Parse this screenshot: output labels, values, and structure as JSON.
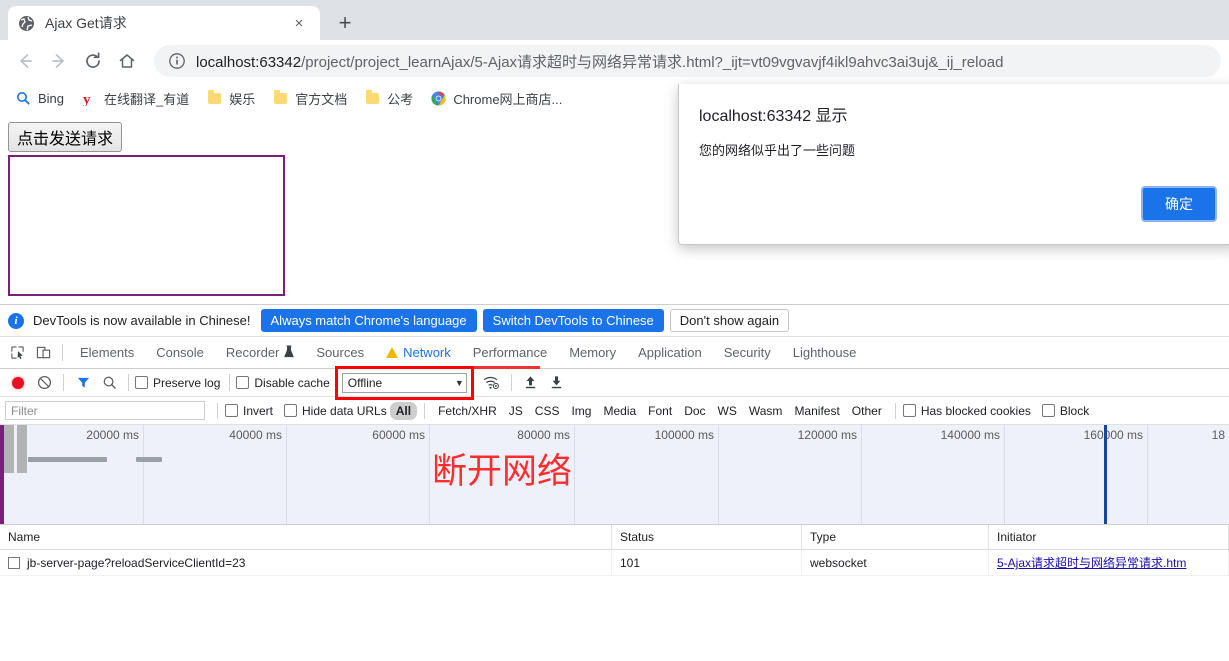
{
  "browser": {
    "tab": {
      "title": "Ajax Get请求",
      "favicon": "globe-icon",
      "close": "×"
    },
    "new_tab_label": "+",
    "nav": {
      "back": "←",
      "forward": "→",
      "reload": "⟳",
      "home": "⌂"
    },
    "omnibox": {
      "url_host": "localhost:63342",
      "url_path": "/project/project_learnAjax/5-Ajax请求超时与网络异常请求.html?_ijt=vt09vgvavjf4ikl9ahvc3ai3uj&_ij_reload",
      "info_icon": "info-circle-icon"
    },
    "bookmarks": [
      {
        "label": "Bing",
        "icon": "bing-search-icon"
      },
      {
        "label": "在线翻译_有道",
        "icon": "youdao-icon"
      },
      {
        "label": "娱乐",
        "icon": "folder-icon"
      },
      {
        "label": "官方文档",
        "icon": "folder-icon"
      },
      {
        "label": "公考",
        "icon": "folder-icon"
      },
      {
        "label": "Chrome网上商店...",
        "icon": "chrome-icon"
      }
    ]
  },
  "page": {
    "send_button": "点击发送请求",
    "result_text": ""
  },
  "dialog": {
    "title": "localhost:63342 显示",
    "message": "您的网络似乎出了一些问题",
    "ok_label": "确定"
  },
  "devtools": {
    "banner": {
      "text": "DevTools is now available in Chinese!",
      "primary1": "Always match Chrome's language",
      "primary2": "Switch DevTools to Chinese",
      "secondary": "Don't show again"
    },
    "tabs": [
      {
        "label": "Elements",
        "active": false
      },
      {
        "label": "Console",
        "active": false
      },
      {
        "label": "Recorder",
        "active": false,
        "badge": "experiment-flask-icon"
      },
      {
        "label": "Sources",
        "active": false
      },
      {
        "label": "Network",
        "active": true,
        "badge": "warning-triangle-icon"
      },
      {
        "label": "Performance",
        "active": false
      },
      {
        "label": "Memory",
        "active": false
      },
      {
        "label": "Application",
        "active": false
      },
      {
        "label": "Security",
        "active": false
      },
      {
        "label": "Lighthouse",
        "active": false
      }
    ],
    "network_toolbar": {
      "record": "record-button-icon",
      "clear": "clear-icon",
      "filter": "filter-funnel-icon",
      "search": "search-icon",
      "preserve_log": "Preserve log",
      "disable_cache": "Disable cache",
      "throttle_value": "Offline",
      "throttle_caret": "▼",
      "wifi_settings": "wifi-settings-icon",
      "upload": "upload-arrow-icon",
      "download": "download-arrow-icon",
      "highlight_color": "#ff0000"
    },
    "filter_bar": {
      "filter_placeholder": "Filter",
      "invert": "Invert",
      "hide_data_urls": "Hide data URLs",
      "types": [
        "All",
        "Fetch/XHR",
        "JS",
        "CSS",
        "Img",
        "Media",
        "Font",
        "Doc",
        "WS",
        "Wasm",
        "Manifest",
        "Other"
      ],
      "selected_type": "All",
      "has_blocked_cookies": "Has blocked cookies",
      "blocked_requests": "Block"
    },
    "overview": {
      "ticks": [
        "20000 ms",
        "40000 ms",
        "60000 ms",
        "80000 ms",
        "100000 ms",
        "120000 ms",
        "140000 ms",
        "160000 ms",
        "18"
      ],
      "annotation": "断开网络",
      "annotation_color": "#ff2d2d"
    },
    "table": {
      "columns": [
        "Name",
        "Status",
        "Type",
        "Initiator"
      ],
      "rows": [
        {
          "name": "jb-server-page?reloadServiceClientId=23",
          "status": "101",
          "type": "websocket",
          "initiator": "5-Ajax请求超时与网络异常请求.htm"
        }
      ]
    }
  }
}
